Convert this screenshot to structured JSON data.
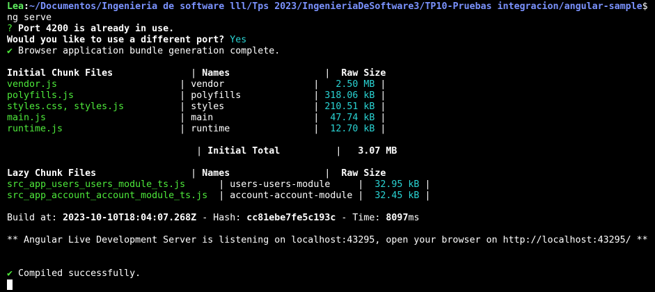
{
  "prompt": {
    "user": "Lea",
    "path": "~/Documentos/Ingenieria de software lll/Tps 2023/IngenieriaDeSoftware3/TP10-Pruebas integracion/angular-sample",
    "symbol": "$"
  },
  "command": "ng serve",
  "port_question": {
    "mark": "?",
    "text": "Port 4200 is already in use.",
    "question": "Would you like to use a different port?",
    "answer": "Yes"
  },
  "bundle_status": {
    "check": "✔",
    "text": "Browser application bundle generation complete."
  },
  "initial_table": {
    "header": {
      "files": "Initial Chunk Files",
      "names": "Names",
      "size": "Raw Size"
    },
    "rows": [
      {
        "file": "vendor.js",
        "name": "vendor",
        "size": "2.50 MB"
      },
      {
        "file": "polyfills.js",
        "name": "polyfills",
        "size": "318.06 kB"
      },
      {
        "file": "styles.css, styles.js",
        "name": "styles",
        "size": "210.51 kB"
      },
      {
        "file": "main.js",
        "name": "main",
        "size": "47.74 kB"
      },
      {
        "file": "runtime.js",
        "name": "runtime",
        "size": "12.70 kB"
      }
    ],
    "total_label": "Initial Total",
    "total_value": "3.07 MB"
  },
  "lazy_table": {
    "header": {
      "files": "Lazy Chunk Files",
      "names": "Names",
      "size": "Raw Size"
    },
    "rows": [
      {
        "file": "src_app_users_users_module_ts.js",
        "name": "users-users-module",
        "size": "32.95 kB"
      },
      {
        "file": "src_app_account_account_module_ts.js",
        "name": "account-account-module",
        "size": "32.45 kB"
      }
    ]
  },
  "build": {
    "label": "Build at: ",
    "date": "2023-10-10T18:04:07.268Z",
    "hash_label": " - Hash: ",
    "hash": "cc81ebe7fe5c193c",
    "time_label": " - Time: ",
    "time": "8097",
    "time_unit": "ms"
  },
  "server_message": "** Angular Live Development Server is listening on localhost:43295, open your browser on http://localhost:43295/ **",
  "compiled": {
    "check": "✔",
    "text": "Compiled successfully."
  },
  "colors": {
    "background": "#000000",
    "foreground": "#ffffff",
    "green": "#4eea3b",
    "blue": "#7b93ff",
    "cyan": "#2ad4d4"
  }
}
